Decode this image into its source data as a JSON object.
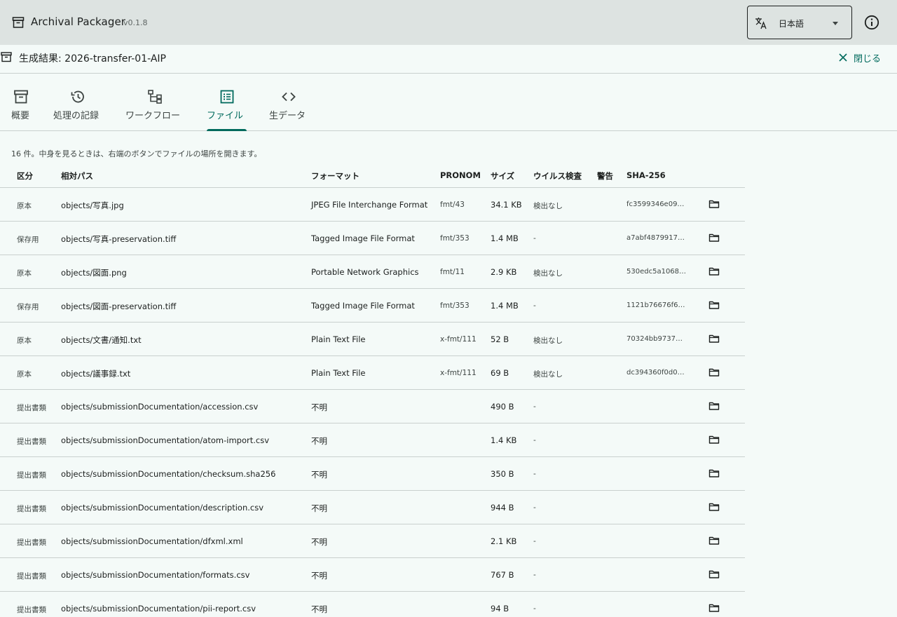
{
  "app": {
    "title": "Archival Packager",
    "version": "v0.1.8",
    "icon": "archive-box-icon"
  },
  "language": {
    "selected": "日本語",
    "icon": "translate-icon"
  },
  "result": {
    "title": "生成結果: 2026-transfer-01-AIP",
    "close_label": "閉じる"
  },
  "tabs": [
    {
      "label": "概要",
      "icon": "archive-icon",
      "active": false
    },
    {
      "label": "処理の記録",
      "icon": "history-icon",
      "active": false
    },
    {
      "label": "ワークフロー",
      "icon": "workflow-icon",
      "active": false
    },
    {
      "label": "ファイル",
      "icon": "list-icon",
      "active": true
    },
    {
      "label": "生データ",
      "icon": "code-icon",
      "active": false
    }
  ],
  "summary": "16 件。中身を見るときは、右端のボタンでファイルの場所を開きます。",
  "table": {
    "headers": {
      "kind": "区分",
      "path": "相対パス",
      "format": "フォーマット",
      "pronom": "PRONOM",
      "size": "サイズ",
      "virus": "ウイルス検査",
      "warning": "警告",
      "hash": "SHA-256"
    },
    "rows": [
      {
        "kind": "原本",
        "path": "objects/写真.jpg",
        "format": "JPEG File Interchange Format",
        "pronom": "fmt/43",
        "size": "34.1 KB",
        "virus": "検出なし",
        "warning": "",
        "hash": "fc3599346e09…"
      },
      {
        "kind": "保存用",
        "path": "objects/写真-preservation.tiff",
        "format": "Tagged Image File Format",
        "pronom": "fmt/353",
        "size": "1.4 MB",
        "virus": "-",
        "warning": "",
        "hash": "a7abf4879917…"
      },
      {
        "kind": "原本",
        "path": "objects/図面.png",
        "format": "Portable Network Graphics",
        "pronom": "fmt/11",
        "size": "2.9 KB",
        "virus": "検出なし",
        "warning": "",
        "hash": "530edc5a1068…"
      },
      {
        "kind": "保存用",
        "path": "objects/図面-preservation.tiff",
        "format": "Tagged Image File Format",
        "pronom": "fmt/353",
        "size": "1.4 MB",
        "virus": "-",
        "warning": "",
        "hash": "1121b76676f6…"
      },
      {
        "kind": "原本",
        "path": "objects/文書/通知.txt",
        "format": "Plain Text File",
        "pronom": "x-fmt/111",
        "size": "52 B",
        "virus": "検出なし",
        "warning": "",
        "hash": "70324bb97376…"
      },
      {
        "kind": "原本",
        "path": "objects/議事録.txt",
        "format": "Plain Text File",
        "pronom": "x-fmt/111",
        "size": "69 B",
        "virus": "検出なし",
        "warning": "",
        "hash": "dc394360f0d0…"
      },
      {
        "kind": "提出書類",
        "path": "objects/submissionDocumentation/accession.csv",
        "format": "不明",
        "pronom": "",
        "size": "490 B",
        "virus": "-",
        "warning": "",
        "hash": ""
      },
      {
        "kind": "提出書類",
        "path": "objects/submissionDocumentation/atom-import.csv",
        "format": "不明",
        "pronom": "",
        "size": "1.4 KB",
        "virus": "-",
        "warning": "",
        "hash": ""
      },
      {
        "kind": "提出書類",
        "path": "objects/submissionDocumentation/checksum.sha256",
        "format": "不明",
        "pronom": "",
        "size": "350 B",
        "virus": "-",
        "warning": "",
        "hash": ""
      },
      {
        "kind": "提出書類",
        "path": "objects/submissionDocumentation/description.csv",
        "format": "不明",
        "pronom": "",
        "size": "944 B",
        "virus": "-",
        "warning": "",
        "hash": ""
      },
      {
        "kind": "提出書類",
        "path": "objects/submissionDocumentation/dfxml.xml",
        "format": "不明",
        "pronom": "",
        "size": "2.1 KB",
        "virus": "-",
        "warning": "",
        "hash": ""
      },
      {
        "kind": "提出書類",
        "path": "objects/submissionDocumentation/formats.csv",
        "format": "不明",
        "pronom": "",
        "size": "767 B",
        "virus": "-",
        "warning": "",
        "hash": ""
      },
      {
        "kind": "提出書類",
        "path": "objects/submissionDocumentation/pii-report.csv",
        "format": "不明",
        "pronom": "",
        "size": "94 B",
        "virus": "-",
        "warning": "",
        "hash": ""
      }
    ]
  },
  "colors": {
    "accent": "#006a5d",
    "appbar": "#dde3e1",
    "background": "#f4faf8",
    "divider": "#c9d0ce"
  }
}
